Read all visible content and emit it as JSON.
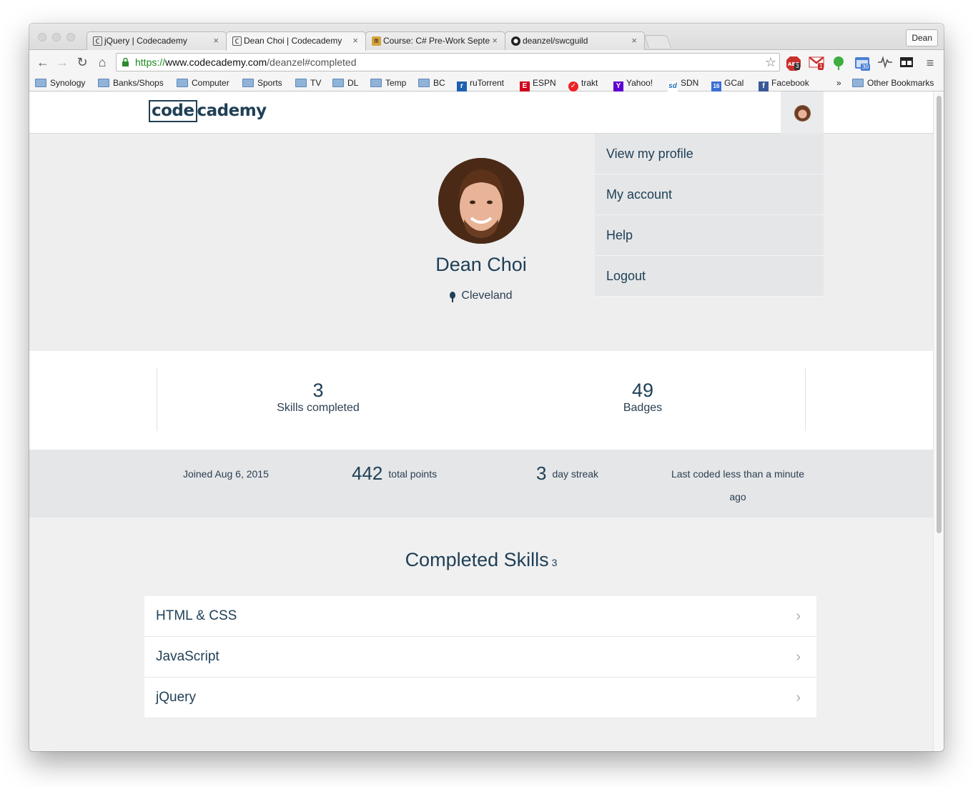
{
  "browser": {
    "tabs": [
      {
        "title": "jQuery | Codecademy",
        "icon": "codecademy-favicon"
      },
      {
        "title": "Dean Choi | Codecademy",
        "icon": "codecademy-favicon"
      },
      {
        "title": "Course: C# Pre-Work Septe",
        "icon": "moodle-favicon"
      },
      {
        "title": "deanzel/swcguild",
        "icon": "github-favicon"
      }
    ],
    "user_button": "Dean",
    "url": {
      "scheme": "https://",
      "host": "www.codecademy.com",
      "path": "/deanzel#completed"
    },
    "extensions": {
      "abp_badge": "3",
      "gmail_badge": "1",
      "calendar_badge": "30"
    },
    "bookmarks": [
      {
        "label": "Synology",
        "icon": "folder"
      },
      {
        "label": "Banks/Shops",
        "icon": "folder"
      },
      {
        "label": "Computer",
        "icon": "folder"
      },
      {
        "label": "Sports",
        "icon": "folder"
      },
      {
        "label": "TV",
        "icon": "folder"
      },
      {
        "label": "DL",
        "icon": "folder"
      },
      {
        "label": "Temp",
        "icon": "folder"
      },
      {
        "label": "BC",
        "icon": "folder"
      },
      {
        "label": "ruTorrent",
        "icon": "rutorrent-icon"
      },
      {
        "label": "ESPN",
        "icon": "espn-icon"
      },
      {
        "label": "trakt",
        "icon": "trakt-icon"
      },
      {
        "label": "Yahoo!",
        "icon": "yahoo-icon"
      },
      {
        "label": "SDN",
        "icon": "sdn-icon"
      },
      {
        "label": "GCal",
        "icon": "gcal-icon"
      },
      {
        "label": "Facebook",
        "icon": "facebook-icon"
      }
    ],
    "overflow_chevron": "»",
    "other_bookmarks": "Other Bookmarks"
  },
  "site": {
    "logo_boxed": "code",
    "logo_rest": "cademy"
  },
  "dropdown": {
    "items": [
      "View my profile",
      "My account",
      "Help",
      "Logout"
    ]
  },
  "profile": {
    "name": "Dean Choi",
    "location": "Cleveland"
  },
  "stats": {
    "skills_completed": {
      "value": "3",
      "label": "Skills completed"
    },
    "badges": {
      "value": "49",
      "label": "Badges"
    }
  },
  "info": {
    "joined": "Joined Aug 6, 2015",
    "points_value": "442",
    "points_label": "total points",
    "streak_value": "3",
    "streak_label": "day streak",
    "last_coded_line1": "Last coded less than a minute",
    "last_coded_line2": "ago"
  },
  "skills": {
    "title": "Completed Skills",
    "count": "3",
    "items": [
      "HTML & CSS",
      "JavaScript",
      "jQuery"
    ]
  },
  "colors": {
    "accent": "#204056",
    "dropdown_bg": "#e4e6e8"
  }
}
